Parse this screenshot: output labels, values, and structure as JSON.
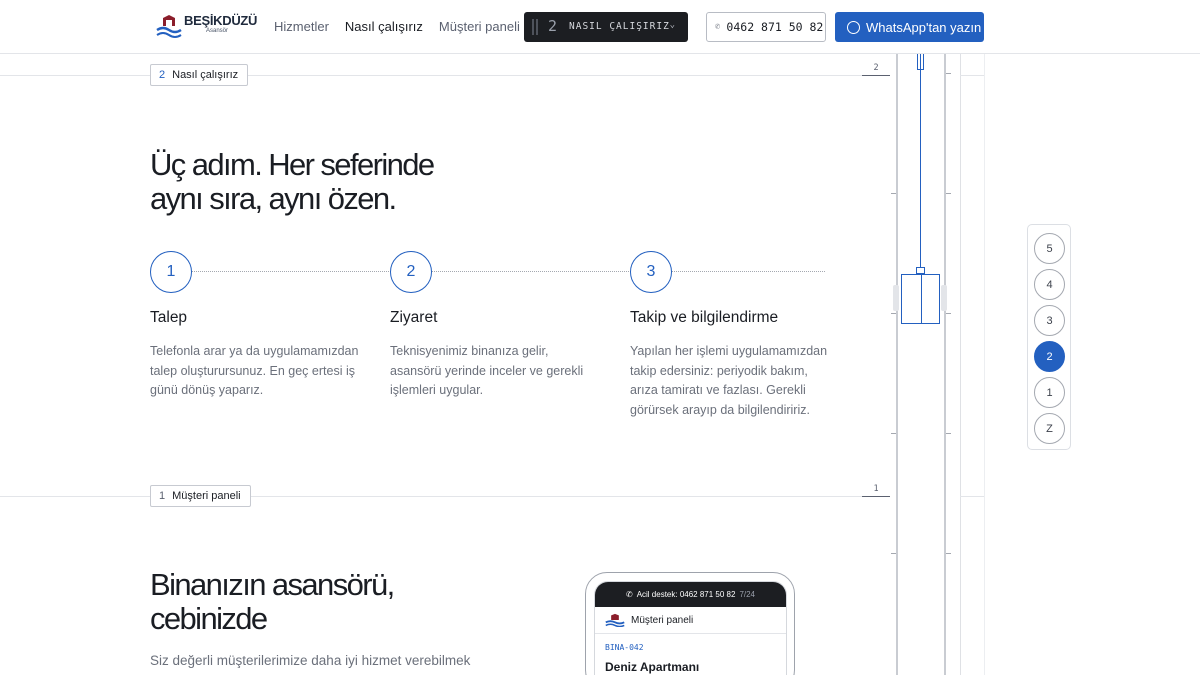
{
  "header": {
    "logo_text": "BEŞİKDÜZÜ",
    "logo_sub": "Asansör",
    "nav": [
      {
        "label": "Hizmetler",
        "active": false
      },
      {
        "label": "Nasıl çalışırız",
        "active": true
      },
      {
        "label": "Müşteri paneli",
        "active": false
      }
    ],
    "step_select": {
      "glyph": "2",
      "label": "NASIL ÇALIŞIRIZ",
      "icon": "chevron-down-icon"
    },
    "phone_label": "0462 871 50 82",
    "whatsapp_label": "WhatsApp'tan yazın",
    "accent_color": "#2360c0"
  },
  "section_how": {
    "tag_number": "2",
    "tag_label": "Nasıl çalışırız",
    "floor_mark": "2",
    "title_line1": "Üç adım. Her seferinde",
    "title_line2": "aynı sıra, aynı özen.",
    "steps": [
      {
        "number": "1",
        "title": "Talep",
        "text": "Telefonla arar ya da uygulamamızdan talep oluşturursunuz. En geç ertesi iş günü dönüş yaparız."
      },
      {
        "number": "2",
        "title": "Ziyaret",
        "text": "Teknisyenimiz binanıza gelir, asansörü yerinde inceler ve gerekli işlemleri uygular."
      },
      {
        "number": "3",
        "title": "Takip ve bilgilendirme",
        "text": "Yapılan her işlemi uygulamamızdan takip edersiniz: periyodik bakım, arıza tamiratı ve fazlası. Gerekli görürsek arayıp da bilgilendiririz."
      }
    ]
  },
  "section_panel": {
    "tag_number": "1",
    "tag_label": "Müşteri paneli",
    "floor_mark": "1",
    "title_line1": "Binanızın asansörü,",
    "title_line2": "cebinizde",
    "lead": "Siz değerli müşterilerimize daha iyi hizmet verebilmek",
    "phone_mock": {
      "status_label": "Acil destek: 0462 871 50 82",
      "status_hours": "7/24",
      "header_label": "Müşteri paneli",
      "building_code": "BINA-042",
      "building_name": "Deniz Apartmanı"
    }
  },
  "floor_picker": {
    "floors": [
      "5",
      "4",
      "3",
      "2",
      "1",
      "Z"
    ],
    "active": "2"
  }
}
